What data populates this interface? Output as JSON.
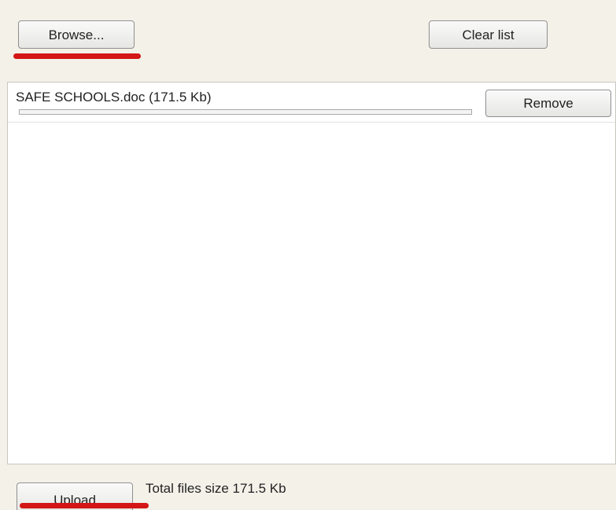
{
  "toolbar": {
    "browse_label": "Browse...",
    "clear_label": "Clear list"
  },
  "files": [
    {
      "name_size": "SAFE SCHOOLS.doc (171.5 Kb)",
      "remove_label": "Remove",
      "progress": 0
    }
  ],
  "footer": {
    "upload_label": "Upload",
    "total_text": "Total files size 171.5 Kb"
  },
  "colors": {
    "background": "#f3f1e8",
    "highlight_underline": "#d31616",
    "list_background": "#ffffff"
  }
}
